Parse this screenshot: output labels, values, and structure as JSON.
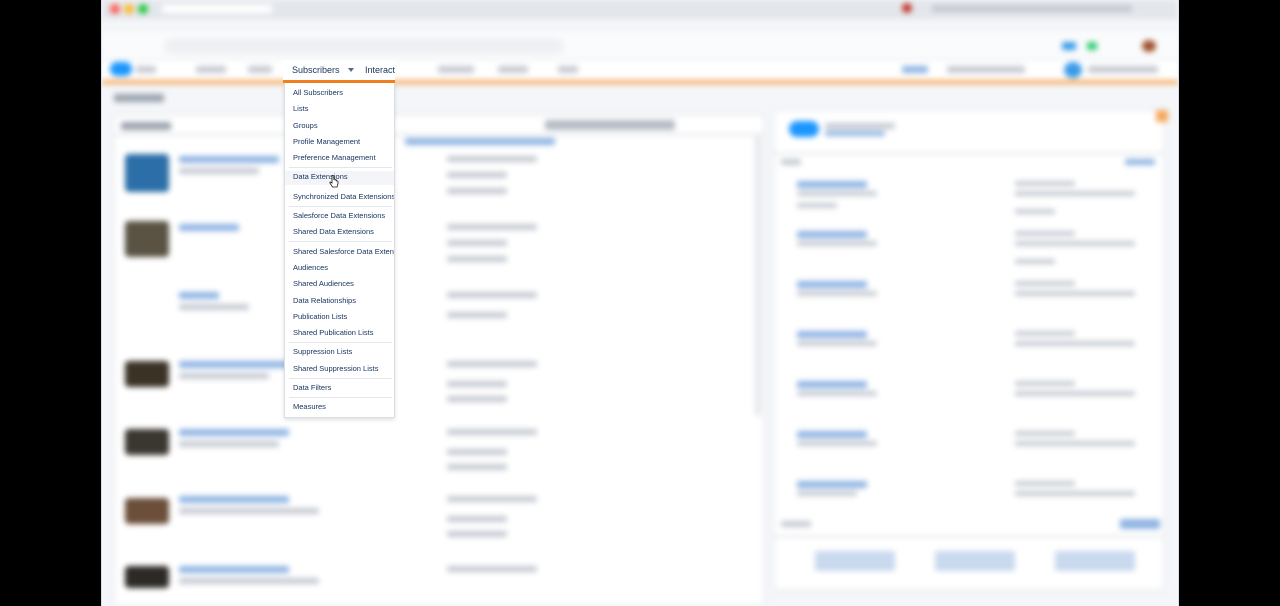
{
  "nav": {
    "active_label": "Subscribers",
    "next_label": "Interactions"
  },
  "dropdown": {
    "items": [
      {
        "label": "All Subscribers"
      },
      {
        "label": "Lists"
      },
      {
        "label": "Groups"
      },
      {
        "label": "Profile Management"
      },
      {
        "label": "Preference Management"
      },
      {
        "label": "Data Extensions"
      },
      {
        "label": "Synchronized Data Extensions"
      },
      {
        "label": "Salesforce Data Extensions"
      },
      {
        "label": "Shared Data Extensions"
      },
      {
        "label": "Shared Salesforce Data Extensions"
      },
      {
        "label": "Audiences"
      },
      {
        "label": "Shared Audiences"
      },
      {
        "label": "Data Relationships"
      },
      {
        "label": "Publication Lists"
      },
      {
        "label": "Shared Publication Lists"
      },
      {
        "label": "Suppression Lists"
      },
      {
        "label": "Shared Suppression Lists"
      },
      {
        "label": "Data Filters"
      },
      {
        "label": "Measures"
      }
    ],
    "hovered_item": "Data Extensions"
  },
  "colors": {
    "accent_orange": "#f07f20",
    "text_navy": "#16325c",
    "brand_blue": "#1b96ff"
  }
}
